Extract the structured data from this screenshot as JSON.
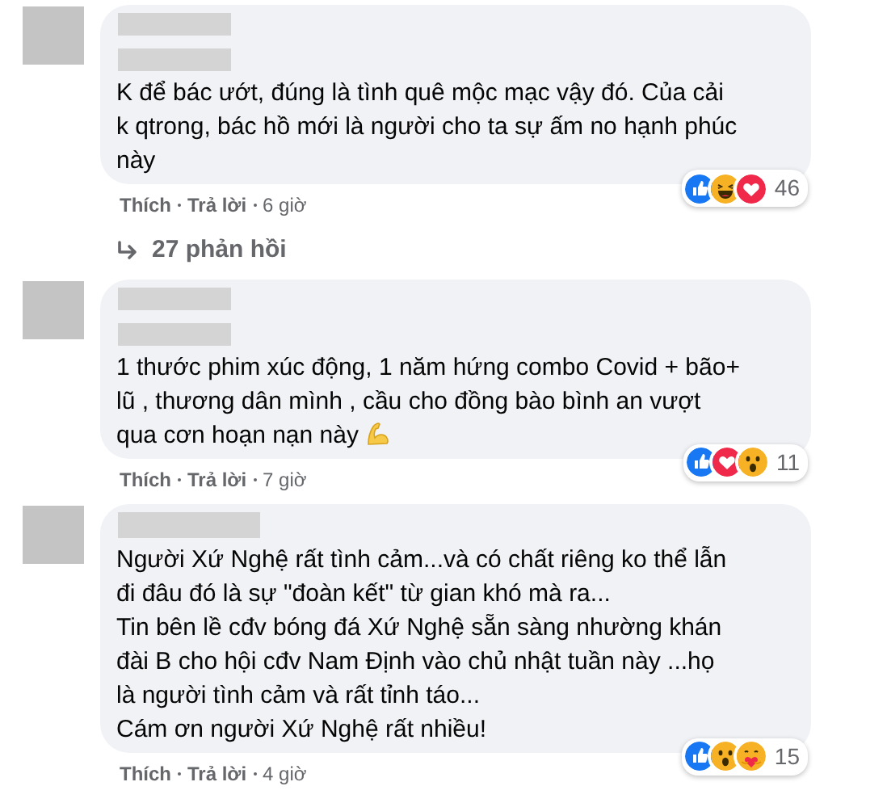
{
  "comments": [
    {
      "name_redaction": {
        "kind": "two-line"
      },
      "paragraphs": [
        "K để bác ướt, đúng là tình quê mộc mạc vậy đó. Của cải k qtrong, bác hồ mới là người cho ta sự ấm no hạnh phúc này"
      ],
      "reactions": [
        {
          "kind": "like"
        },
        {
          "kind": "haha"
        },
        {
          "kind": "love"
        }
      ],
      "reaction_count": "46",
      "actions": [
        "Thích",
        "Trả lời"
      ],
      "time": "6 giờ",
      "replies": "27 phản hồi"
    },
    {
      "name_redaction": {
        "kind": "two-line"
      },
      "paragraphs": [
        "1 thước phim xúc động, 1 năm hứng combo Covid + bão+ lũ , thương dân mình , cầu cho đồng bào bình an vượt qua cơn hoạn nạn này"
      ],
      "emoji": {
        "kind": "muscle"
      },
      "reactions": [
        {
          "kind": "like"
        },
        {
          "kind": "love"
        },
        {
          "kind": "wow"
        }
      ],
      "reaction_count": "11",
      "actions": [
        "Thích",
        "Trả lời"
      ],
      "time": "7 giờ"
    },
    {
      "name_redaction": {
        "kind": "one-line"
      },
      "paragraphs": [
        "Người Xứ Nghệ rất tình cảm...và có chất riêng ko thể lẫn đi đâu đó là sự \"đoàn kết\" từ gian khó mà ra...",
        "Tin bên lề cđv bóng đá Xứ Nghệ sẵn sàng nhường khán đài B cho hội cđv Nam Định vào chủ nhật tuần này ...họ là người tình cảm và rất tỉnh táo...",
        "Cám ơn người Xứ Nghệ rất nhiều!"
      ],
      "reactions": [
        {
          "kind": "like"
        },
        {
          "kind": "wow"
        },
        {
          "kind": "care"
        }
      ],
      "reaction_count": "15",
      "actions": [
        "Thích",
        "Trả lời"
      ],
      "time": "4 giờ"
    }
  ]
}
